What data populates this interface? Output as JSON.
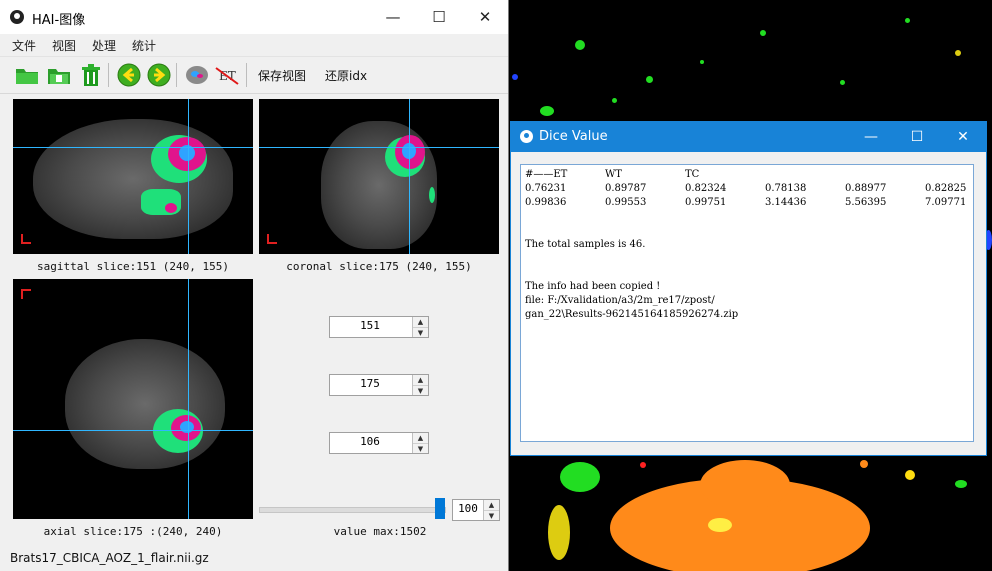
{
  "main_window": {
    "title": "HAI-图像",
    "controls": {
      "minimize": "—",
      "maximize": "☐",
      "close": "✕"
    },
    "menu": [
      "文件",
      "视图",
      "处理",
      "统计"
    ],
    "toolbar": {
      "save_view": "保存视图",
      "restore_idx": "还原idx"
    },
    "views": {
      "sagittal_caption": "sagittal slice:151 (240, 155)",
      "coronal_caption": "coronal slice:175 (240, 155)",
      "axial_caption": "axial slice:175 :(240, 240)"
    },
    "spinboxes": [
      "151",
      "175",
      "106"
    ],
    "slider": {
      "value": "100",
      "level": 0.95
    },
    "value_max": "value max:1502",
    "status": "Brats17_CBICA_AOZ_1_flair.nii.gz"
  },
  "dice_window": {
    "title": "Dice Value",
    "controls": {
      "minimize": "—",
      "maximize": "☐",
      "close": "✕"
    },
    "header": [
      "#——ET",
      "WT",
      "TC"
    ],
    "rows": [
      [
        "0.76231",
        "0.89787",
        "0.82324",
        "0.78138",
        "0.88977",
        "0.82825"
      ],
      [
        "0.99836",
        "0.99553",
        "0.99751",
        "3.14436",
        "5.56395",
        "7.09771"
      ]
    ],
    "total_samples": "The total samples is 46.",
    "copied": "The info had been copied !",
    "file_line1": "file: F:/Xvalidation/a3/2m_re17/zpost/",
    "file_line2": "gan_22\\Results-962145164185926274.zip"
  },
  "colors": {
    "accent": "#1883d7",
    "crosshair": "#2fb6ff",
    "tumor_green": "#1fe07a",
    "tumor_magenta": "#e0148c"
  }
}
